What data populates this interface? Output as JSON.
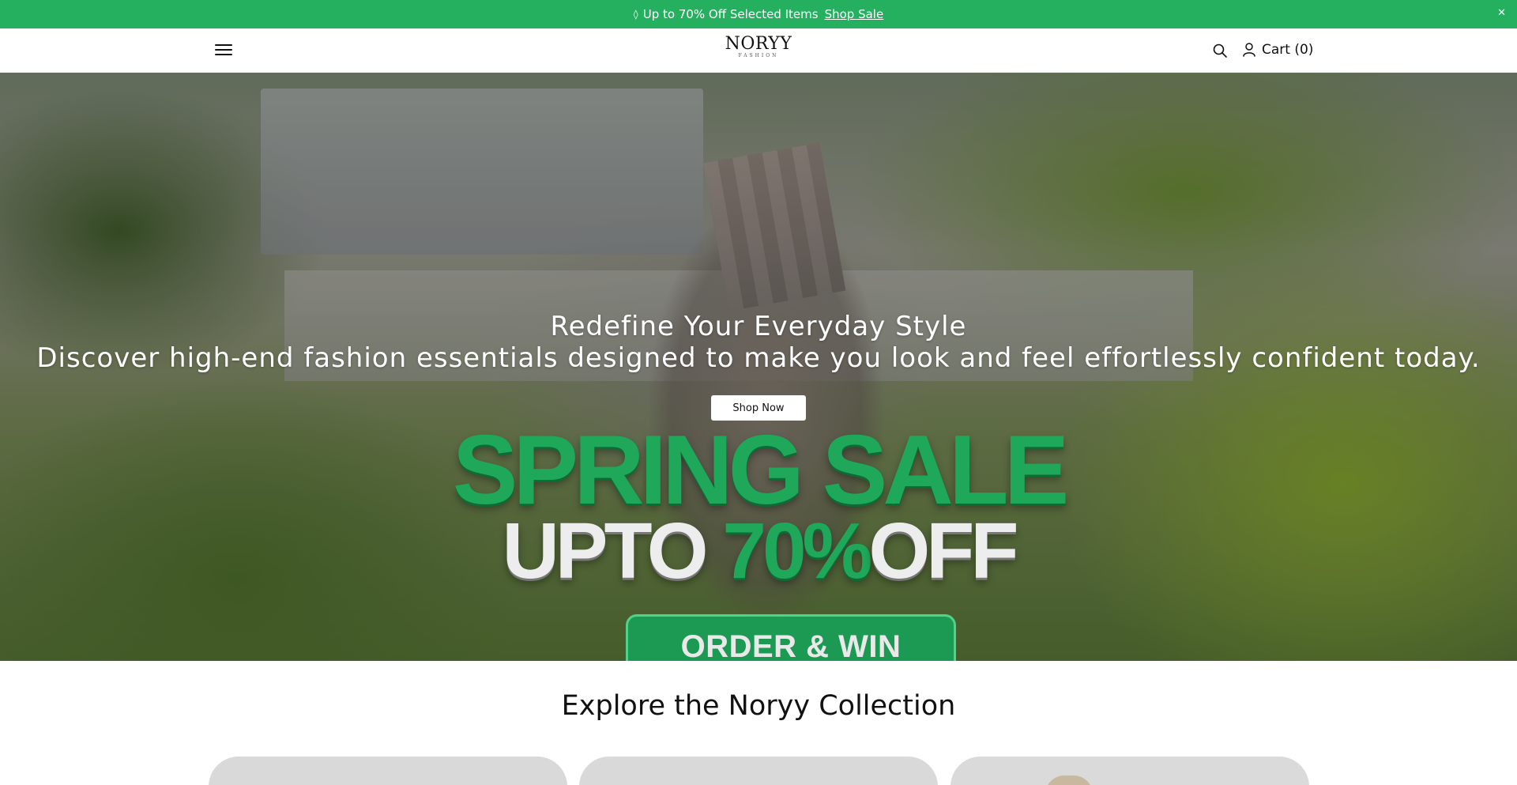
{
  "announcement": {
    "icon": "tag-icon",
    "message": "Up to 70% Off Selected Items",
    "link_label": "Shop Sale",
    "close_icon": "close-icon",
    "bg_color": "#25b060"
  },
  "header": {
    "logo_text": "NORYY",
    "logo_subtext": "FASHION",
    "menu_icon": "hamburger-menu-icon",
    "search_icon": "search-icon",
    "account_icon": "user-icon",
    "cart_label": "Cart (0)"
  },
  "hero": {
    "title": "Redefine Your Everyday Style",
    "subtitle": "Discover high-end fashion essentials designed to make you look and feel effortlessly confident today.",
    "cta_label": "Shop Now",
    "promo_line1": "SPRING SALE",
    "promo_line2_prefix": "UPTO ",
    "promo_line2_pct": "70%",
    "promo_line2_suffix": "OFF",
    "promo_badge": "ORDER & WIN PRIZES",
    "accent_color": "#1fa85a"
  },
  "collection": {
    "title": "Explore the Noryy Collection",
    "cards": [
      {
        "name": "collection-card-1"
      },
      {
        "name": "collection-card-2"
      },
      {
        "name": "collection-card-3"
      }
    ]
  }
}
